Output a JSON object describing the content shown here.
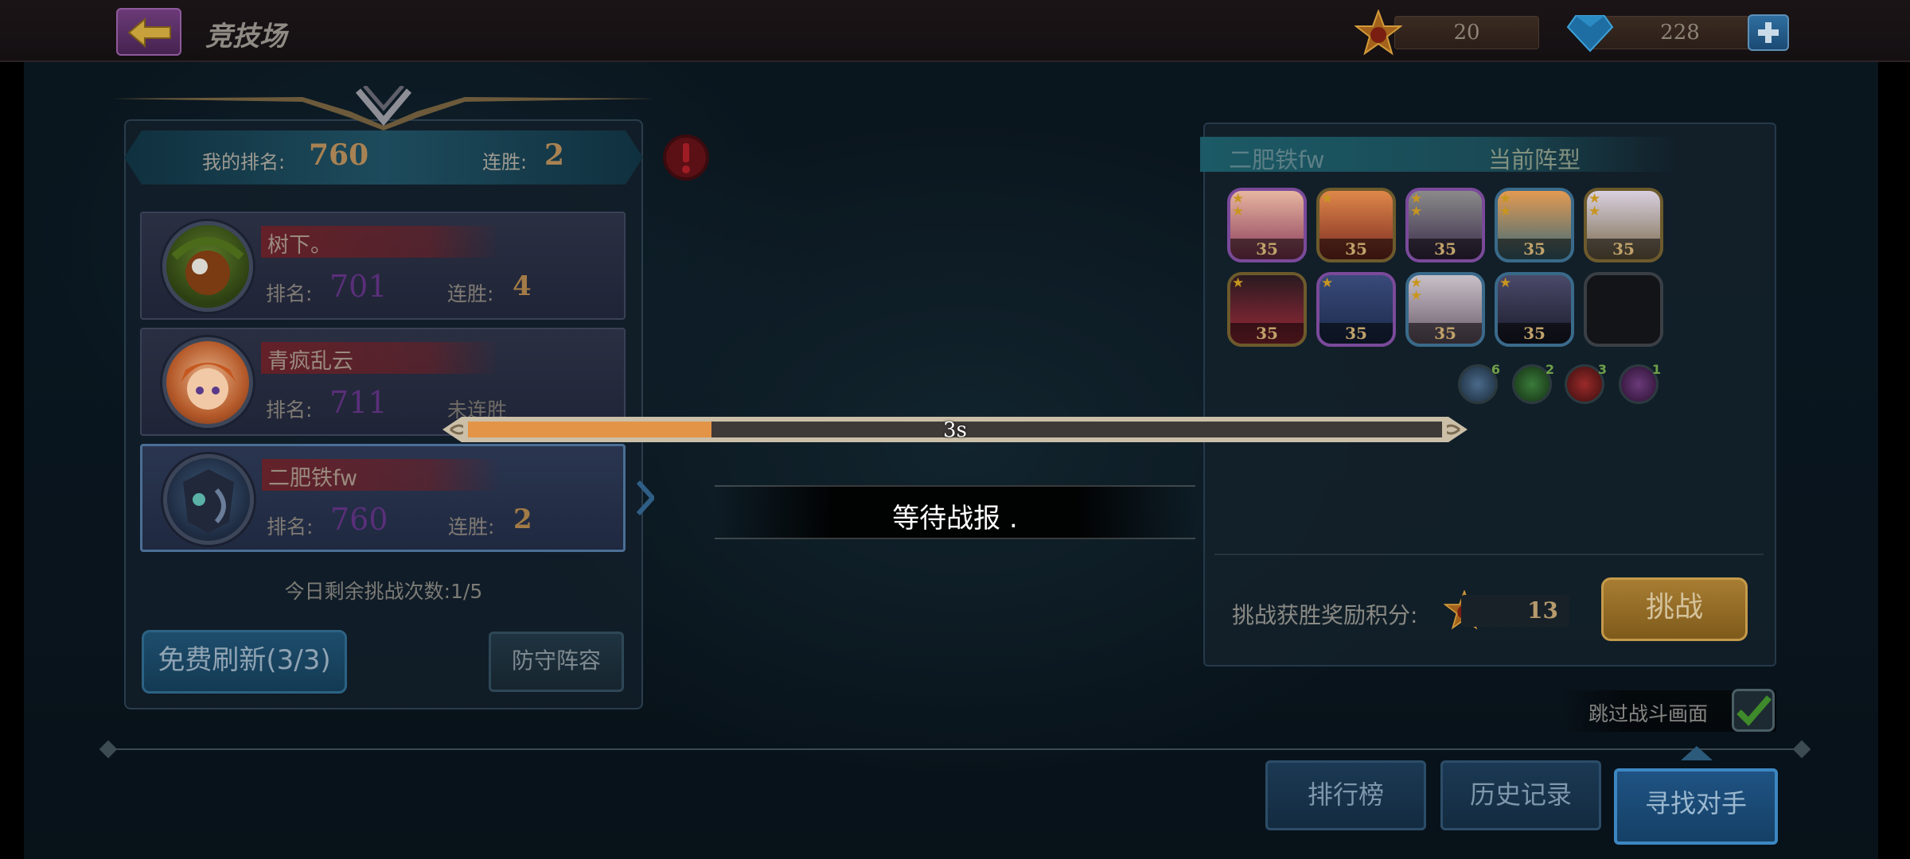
{
  "header": {
    "title": "竞技场",
    "trophy_count": "20",
    "diamond_count": "228"
  },
  "my_status": {
    "rank_label": "我的排名:",
    "rank_value": "760",
    "streak_label": "连胜:",
    "streak_value": "2"
  },
  "opponents": [
    {
      "name": "树下。",
      "rank_label": "排名:",
      "rank": "701",
      "streak_label": "连胜:",
      "streak": "4"
    },
    {
      "name": "青疯乱云",
      "rank_label": "排名:",
      "rank": "711",
      "streak_text": "未连胜"
    },
    {
      "name": "二肥铁fw",
      "rank_label": "排名:",
      "rank": "760",
      "streak_label": "连胜:",
      "streak": "2"
    }
  ],
  "remaining_challenges": "今日剩余挑战次数:1/5",
  "buttons": {
    "free_refresh": "免费刷新(3/3)",
    "defense_lineup": "防守阵容",
    "challenge": "挑战",
    "leaderboard": "排行榜",
    "history": "历史记录",
    "find_opponent": "寻找对手"
  },
  "progress": {
    "label": "3s",
    "fraction": 0.25
  },
  "waiting_text": "等待战报 .",
  "formation": {
    "player_name": "二肥铁fw",
    "title": "当前阵型",
    "hero_level": "35",
    "faction_counts": [
      "6",
      "2",
      "3",
      "1"
    ]
  },
  "reward": {
    "label": "挑战获胜奖励积分:",
    "value": "13"
  },
  "skip_battle": {
    "label": "跳过战斗画面",
    "checked": true
  },
  "colors": {
    "progress_fill": "#e39447",
    "rank_purple": "#5a2f7a",
    "streak_gold": "#a27b47",
    "accent_blue": "#3c87c2"
  }
}
